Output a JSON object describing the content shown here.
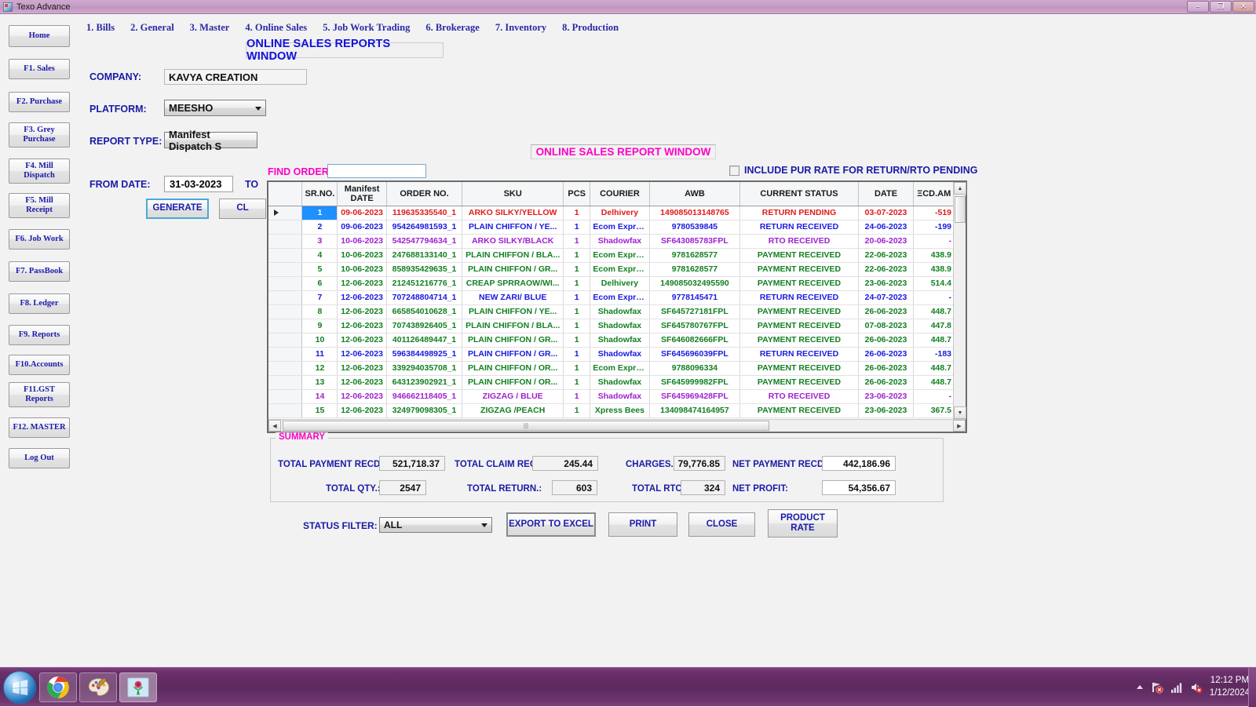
{
  "window": {
    "title": "Texo Advance",
    "icon": "app-icon",
    "controls": {
      "minimize": "–",
      "maximize": "❐",
      "close": "✕"
    }
  },
  "menu": {
    "home_label": "Home",
    "items": [
      {
        "label": "1. Bills"
      },
      {
        "label": "2. General"
      },
      {
        "label": "3. Master"
      },
      {
        "label": "4. Online Sales"
      },
      {
        "label": "5. Job Work Trading"
      },
      {
        "label": "6. Brokerage"
      },
      {
        "label": "7. Inventory"
      },
      {
        "label": "8. Production"
      }
    ]
  },
  "sidebar": {
    "items": [
      {
        "label": "F1. Sales"
      },
      {
        "label": "F2. Purchase"
      },
      {
        "label": "F3. Grey\nPurchase"
      },
      {
        "label": "F4. Mill\nDispatch"
      },
      {
        "label": "F5. Mill\nReceipt"
      },
      {
        "label": "F6. Job Work"
      },
      {
        "label": "F7. PassBook"
      },
      {
        "label": "F8. Ledger"
      },
      {
        "label": "F9. Reports"
      },
      {
        "label": "F10.Accounts"
      },
      {
        "label": "F11.GST\nReports"
      },
      {
        "label": "F12. MASTER"
      },
      {
        "label": "Log Out"
      }
    ]
  },
  "form": {
    "banner_title": "ONLINE SALES REPORTS WINDOW",
    "company_label": "COMPANY:",
    "company_value": "KAVYA CREATION",
    "platform_label": "PLATFORM:",
    "platform_value": "MEESHO",
    "report_type_label": "REPORT TYPE:",
    "report_type_value": "Manifest Dispatch S",
    "from_date_label": "FROM DATE:",
    "from_date_value": "31-03-2023",
    "to_date_label": "TO",
    "generate_label": "GENERATE",
    "close_label": "CL"
  },
  "report": {
    "pink_title": "ONLINE SALES REPORT WINDOW",
    "find_order_label": "FIND ORDER",
    "find_order_value": "",
    "include_checkbox_label": "INCLUDE PUR RATE FOR RETURN/RTO PENDING",
    "include_checkbox_checked": false
  },
  "grid": {
    "columns": [
      {
        "key": "sr",
        "label": "SR.NO."
      },
      {
        "key": "manifest_date",
        "label": "Manifest\nDATE"
      },
      {
        "key": "order_no",
        "label": "ORDER NO."
      },
      {
        "key": "sku",
        "label": "SKU"
      },
      {
        "key": "pcs",
        "label": "PCS"
      },
      {
        "key": "courier",
        "label": "COURIER"
      },
      {
        "key": "awb",
        "label": "AWB"
      },
      {
        "key": "status",
        "label": "CURRENT STATUS"
      },
      {
        "key": "date",
        "label": "DATE"
      },
      {
        "key": "recd_amt",
        "label": "ΞCD.AM"
      }
    ],
    "rows": [
      {
        "sr": "1",
        "manifest_date": "09-06-2023",
        "order_no": "119635335540_1",
        "sku": "ARKO SILKY/YELLOW",
        "pcs": "1",
        "courier": "Delhivery",
        "awb": "149085013148765",
        "status": "RETURN PENDING",
        "date": "03-07-2023",
        "recd_amt": "-519",
        "color": "#e01b1b",
        "selected": true
      },
      {
        "sr": "2",
        "manifest_date": "09-06-2023",
        "order_no": "954264981593_1",
        "sku": "PLAIN CHIFFON /  YE...",
        "pcs": "1",
        "courier": "Ecom Express",
        "awb": "9780539845",
        "status": "RETURN RECEIVED",
        "date": "24-06-2023",
        "recd_amt": "-199",
        "color": "#1a1ae0",
        "selected": false
      },
      {
        "sr": "3",
        "manifest_date": "10-06-2023",
        "order_no": "542547794634_1",
        "sku": "ARKO SILKY/BLACK",
        "pcs": "1",
        "courier": "Shadowfax",
        "awb": "SF643085783FPL",
        "status": "RTO RECEIVED",
        "date": "20-06-2023",
        "recd_amt": "-",
        "color": "#a020d0",
        "selected": false
      },
      {
        "sr": "4",
        "manifest_date": "10-06-2023",
        "order_no": "247688133140_1",
        "sku": "PLAIN CHIFFON / BLA...",
        "pcs": "1",
        "courier": "Ecom Express",
        "awb": "9781628577",
        "status": "PAYMENT RECEIVED",
        "date": "22-06-2023",
        "recd_amt": "438.9",
        "color": "#128022",
        "selected": false
      },
      {
        "sr": "5",
        "manifest_date": "10-06-2023",
        "order_no": "858935429635_1",
        "sku": "PLAIN CHIFFON / GR...",
        "pcs": "1",
        "courier": "Ecom Express",
        "awb": "9781628577",
        "status": "PAYMENT RECEIVED",
        "date": "22-06-2023",
        "recd_amt": "438.9",
        "color": "#128022",
        "selected": false
      },
      {
        "sr": "6",
        "manifest_date": "12-06-2023",
        "order_no": "212451216776_1",
        "sku": "CREAP SPRRAOW/WI...",
        "pcs": "1",
        "courier": "Delhivery",
        "awb": "149085032495590",
        "status": "PAYMENT RECEIVED",
        "date": "23-06-2023",
        "recd_amt": "514.4",
        "color": "#128022",
        "selected": false
      },
      {
        "sr": "7",
        "manifest_date": "12-06-2023",
        "order_no": "707248804714_1",
        "sku": "NEW ZARI/ BLUE",
        "pcs": "1",
        "courier": "Ecom Express",
        "awb": "9778145471",
        "status": "RETURN RECEIVED",
        "date": "24-07-2023",
        "recd_amt": "-",
        "color": "#1a1ae0",
        "selected": false
      },
      {
        "sr": "8",
        "manifest_date": "12-06-2023",
        "order_no": "665854010628_1",
        "sku": "PLAIN CHIFFON /  YE...",
        "pcs": "1",
        "courier": "Shadowfax",
        "awb": "SF645727181FPL",
        "status": "PAYMENT RECEIVED",
        "date": "26-06-2023",
        "recd_amt": "448.7",
        "color": "#128022",
        "selected": false
      },
      {
        "sr": "9",
        "manifest_date": "12-06-2023",
        "order_no": "707438926405_1",
        "sku": "PLAIN CHIFFON / BLA...",
        "pcs": "1",
        "courier": "Shadowfax",
        "awb": "SF645780767FPL",
        "status": "PAYMENT RECEIVED",
        "date": "07-08-2023",
        "recd_amt": "447.8",
        "color": "#128022",
        "selected": false
      },
      {
        "sr": "10",
        "manifest_date": "12-06-2023",
        "order_no": "401126489447_1",
        "sku": "PLAIN CHIFFON / GR...",
        "pcs": "1",
        "courier": "Shadowfax",
        "awb": "SF646082666FPL",
        "status": "PAYMENT RECEIVED",
        "date": "26-06-2023",
        "recd_amt": "448.7",
        "color": "#128022",
        "selected": false
      },
      {
        "sr": "11",
        "manifest_date": "12-06-2023",
        "order_no": "596384498925_1",
        "sku": "PLAIN CHIFFON / GR...",
        "pcs": "1",
        "courier": "Shadowfax",
        "awb": "SF645696039FPL",
        "status": "RETURN RECEIVED",
        "date": "26-06-2023",
        "recd_amt": "-183",
        "color": "#1a1ae0",
        "selected": false
      },
      {
        "sr": "12",
        "manifest_date": "12-06-2023",
        "order_no": "339294035708_1",
        "sku": "PLAIN CHIFFON / OR...",
        "pcs": "1",
        "courier": "Ecom Express",
        "awb": "9788096334",
        "status": "PAYMENT RECEIVED",
        "date": "26-06-2023",
        "recd_amt": "448.7",
        "color": "#128022",
        "selected": false
      },
      {
        "sr": "13",
        "manifest_date": "12-06-2023",
        "order_no": "643123902921_1",
        "sku": "PLAIN CHIFFON / OR...",
        "pcs": "1",
        "courier": "Shadowfax",
        "awb": "SF645999982FPL",
        "status": "PAYMENT RECEIVED",
        "date": "26-06-2023",
        "recd_amt": "448.7",
        "color": "#128022",
        "selected": false
      },
      {
        "sr": "14",
        "manifest_date": "12-06-2023",
        "order_no": "946662118405_1",
        "sku": "ZIGZAG / BLUE",
        "pcs": "1",
        "courier": "Shadowfax",
        "awb": "SF645969428FPL",
        "status": "RTO RECEIVED",
        "date": "23-06-2023",
        "recd_amt": "-",
        "color": "#a020d0",
        "selected": false
      },
      {
        "sr": "15",
        "manifest_date": "12-06-2023",
        "order_no": "324979098305_1",
        "sku": "ZIGZAG /PEACH",
        "pcs": "1",
        "courier": "Xpress Bees",
        "awb": "134098474164957",
        "status": "PAYMENT RECEIVED",
        "date": "23-06-2023",
        "recd_amt": "367.5",
        "color": "#128022",
        "selected": false
      }
    ]
  },
  "summary": {
    "legend": "SUMMARY",
    "total_payment_recd_label": "TOTAL PAYMENT RECD.:",
    "total_payment_recd_value": "521,718.37",
    "total_claim_recd_label": "TOTAL CLAIM RECD.:",
    "total_claim_recd_value": "245.44",
    "charges_label": "CHARGES.:",
    "charges_value": "79,776.85",
    "net_payment_recd_label": "NET PAYMENT RECD.:",
    "net_payment_recd_value": "442,186.96",
    "total_qty_label": "TOTAL QTY.:",
    "total_qty_value": "2547",
    "total_return_label": "TOTAL RETURN.:",
    "total_return_value": "603",
    "total_rto_label": "TOTAL RTO.:",
    "total_rto_value": "324",
    "net_profit_label": "NET PROFIT:",
    "net_profit_value": "54,356.67"
  },
  "actions": {
    "status_filter_label": "STATUS FILTER:",
    "status_filter_value": "ALL",
    "export_label": "EXPORT TO EXCEL",
    "print_label": "PRINT",
    "close_label": "CLOSE",
    "product_rate_label": "PRODUCT\nRATE"
  },
  "taskbar": {
    "start_label": "start-orb",
    "apps": [
      {
        "name": "chrome-taskbar-icon"
      },
      {
        "name": "paint-taskbar-icon"
      },
      {
        "name": "image-viewer-taskbar-icon"
      }
    ],
    "tray": [
      {
        "name": "network-error-icon"
      },
      {
        "name": "signal-bars-icon"
      },
      {
        "name": "volume-muted-icon"
      }
    ],
    "clock_time": "12:12 PM",
    "clock_date": "1/12/2024"
  }
}
